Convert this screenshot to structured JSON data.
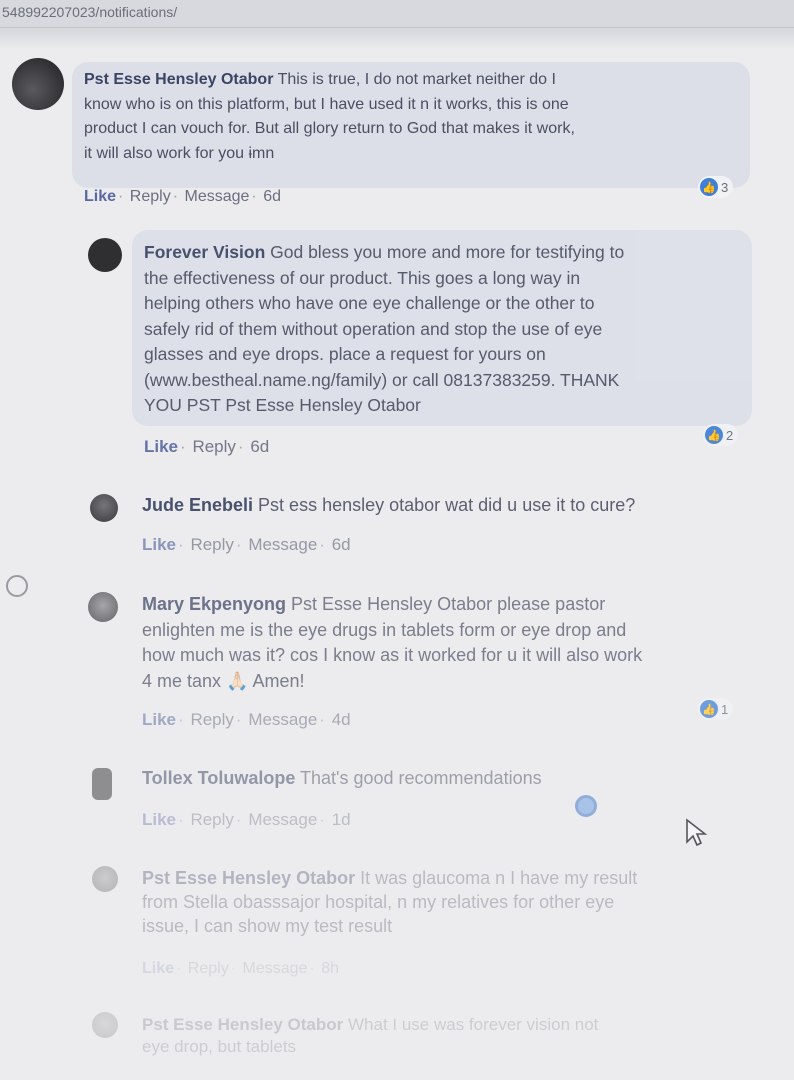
{
  "browser": {
    "url": "548992207023/notifications/"
  },
  "comments": [
    {
      "author": "Pst Esse Hensley Otabor",
      "lines": [
        " This is true, I do not market neither do I",
        "know who is on this platform, but I have used it n it works, this is one",
        "product I can vouch for. But all glory return to God that makes it work,",
        "it will also work for you ɨmn"
      ],
      "actions": {
        "like": "Like",
        "reply": "Reply",
        "message": "Message",
        "time": "6d"
      },
      "reactions": "3"
    },
    {
      "author": "Forever Vision",
      "lines": [
        " God bless you more and more for testifying to",
        "the effectiveness of our product. This goes a long way in",
        "helping others who have one eye challenge or the other to",
        "safely rid of them without operation and stop the use of eye",
        "glasses and eye drops. place a request for yours on",
        "(www.bestheal.name.ng/family) or call 08137383259. THANK",
        "YOU PST Pst Esse Hensley Otabor"
      ],
      "actions": {
        "like": "Like",
        "reply": "Reply",
        "time": "6d"
      },
      "reactions": "2"
    },
    {
      "author": "Jude Enebeli",
      "lines": [
        " Pst ess hensley otabor wat did u use it to cure?"
      ],
      "actions": {
        "like": "Like",
        "reply": "Reply",
        "message": "Message",
        "time": "6d"
      }
    },
    {
      "author": "Mary Ekpenyong",
      "lines": [
        " Pst Esse Hensley Otabor please pastor",
        "enlighten me is the eye drugs in tablets form or eye drop and",
        "how much was it? cos I know as it worked for u it will also work",
        "4 me tanx 🙏🏻 Amen!"
      ],
      "actions": {
        "like": "Like",
        "reply": "Reply",
        "message": "Message",
        "time": "4d"
      },
      "reactions": "1"
    },
    {
      "author": "Tollex Toluwalope",
      "lines": [
        " That's good recommendations"
      ],
      "actions": {
        "like": "Like",
        "reply": "Reply",
        "message": "Message",
        "time": "1d"
      }
    },
    {
      "author": "Pst Esse Hensley Otabor",
      "lines": [
        " It was glaucoma n I have my result",
        "from Stella obasssajor hospital, n my relatives for other eye",
        "issue, I can show my test result"
      ],
      "actions": {
        "like": "Like",
        "reply": "Reply",
        "message": "Message",
        "time": "8h"
      }
    },
    {
      "author": "Pst Esse Hensley Otabor",
      "lines": [
        " What I use was forever vision not",
        "eye drop, but tablets"
      ]
    }
  ],
  "colors": {
    "bubble": "#dcdfe8",
    "author": "#3b4463",
    "like": "#5a6aa0",
    "reaction": "#3f7fd8"
  }
}
